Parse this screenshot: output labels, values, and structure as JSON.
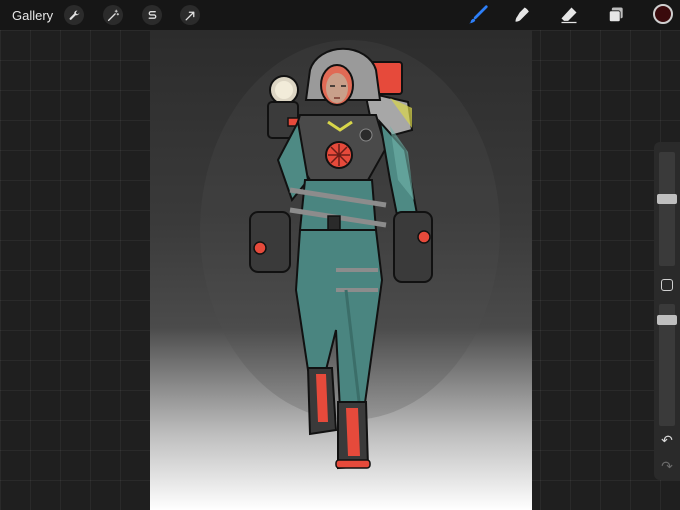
{
  "topbar": {
    "gallery_label": "Gallery",
    "left_tools": [
      {
        "name": "actions",
        "icon": "wrench-icon"
      },
      {
        "name": "adjustments",
        "icon": "magic-wand-icon"
      },
      {
        "name": "selection",
        "icon": "selection-s-icon"
      },
      {
        "name": "transform",
        "icon": "arrow-cursor-icon"
      }
    ],
    "right_tools": [
      {
        "name": "brush",
        "icon": "brush-icon",
        "active": true
      },
      {
        "name": "smudge",
        "icon": "smudge-icon",
        "active": false
      },
      {
        "name": "eraser",
        "icon": "eraser-icon",
        "active": false
      },
      {
        "name": "layers",
        "icon": "layers-icon",
        "active": false
      }
    ],
    "current_color": "#3a0a0c",
    "accent": "#2d7ff9"
  },
  "sidebar": {
    "brush_size_level": 0.6,
    "brush_opacity_level": 0.9,
    "undo_icon": "undo-icon",
    "redo_icon": "redo-icon"
  },
  "canvas": {
    "artwork": "illustration"
  }
}
